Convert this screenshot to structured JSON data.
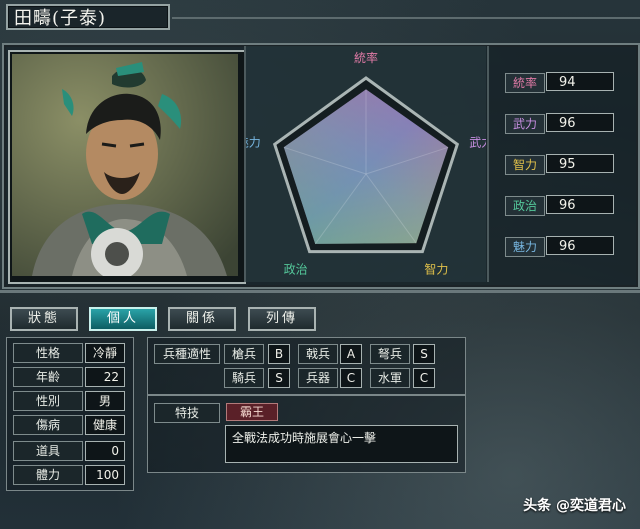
{
  "header": {
    "name": "田疇(子泰)"
  },
  "radar": {
    "labels": [
      "統率",
      "武力",
      "智力",
      "政治",
      "魅力"
    ],
    "label_colors": [
      "#e07aa6",
      "#c68ee0",
      "#e0c04a",
      "#54c79a",
      "#77b6e0"
    ],
    "values": [
      94,
      96,
      95,
      96,
      96
    ],
    "max": 100
  },
  "stats": [
    {
      "label": "統率",
      "value": "94",
      "color": "#e07aa6"
    },
    {
      "label": "武力",
      "value": "96",
      "color": "#c68ee0"
    },
    {
      "label": "智力",
      "value": "95",
      "color": "#e0c04a"
    },
    {
      "label": "政治",
      "value": "96",
      "color": "#54c79a"
    },
    {
      "label": "魅力",
      "value": "96",
      "color": "#77b6e0"
    }
  ],
  "tabs": [
    {
      "label": "狀態",
      "active": false
    },
    {
      "label": "個人",
      "active": true
    },
    {
      "label": "關係",
      "active": false
    },
    {
      "label": "列傳",
      "active": false
    }
  ],
  "personal": [
    {
      "label": "性格",
      "value": "冷靜"
    },
    {
      "label": "年齡",
      "value": "22"
    },
    {
      "label": "性別",
      "value": "男"
    },
    {
      "label": "傷病",
      "value": "健康"
    },
    {
      "label": "道具",
      "value": "0"
    },
    {
      "label": "體力",
      "value": "100"
    }
  ],
  "troops": {
    "title": "兵種適性",
    "items": [
      {
        "label": "槍兵",
        "grade": "B"
      },
      {
        "label": "戟兵",
        "grade": "A"
      },
      {
        "label": "弩兵",
        "grade": "S"
      },
      {
        "label": "騎兵",
        "grade": "S"
      },
      {
        "label": "兵器",
        "grade": "C"
      },
      {
        "label": "水軍",
        "grade": "C"
      }
    ]
  },
  "skill": {
    "title": "特技",
    "name": "霸王",
    "description": "全戰法成功時施展會心一擊"
  },
  "watermark": "头条 @奕道君心"
}
